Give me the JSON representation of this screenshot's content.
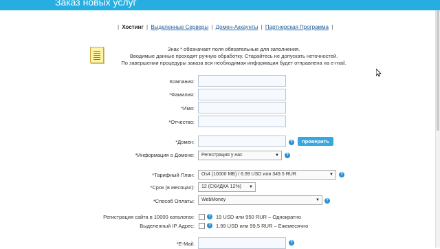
{
  "header": {
    "title": "Заказ новых услуг"
  },
  "nav": {
    "active": "Хостинг",
    "links": [
      "Выделенные Серверы",
      "Домен-Аккаунты",
      "Партнерская Программа"
    ]
  },
  "notes": {
    "line1": "Знак * обозначает поля обязательные для заполнения.",
    "line2": "Вводимые данные проходят ручную обработку. Старайтесь не допускать неточностей.",
    "line3": "По завершении процедуры заказа вся необходимая информация будет отправлена на e-mail."
  },
  "form": {
    "company_label": "Компания:",
    "lastname_label": "*Фамилия:",
    "firstname_label": "*Имя:",
    "middlename_label": "*Отчество:",
    "domain_label": "*Домен:",
    "check_button": "проверить",
    "domain_info_label": "*Информация о Домене:",
    "domain_info_value": "Регистрация у нас",
    "plan_label": "*Тарифный План:",
    "plan_value": "Os4 (10000 МБ) / 6.99 USD или 349.5 RUR",
    "term_label": "*Срок (в месяцах):",
    "term_value": "12 (СКИДКА 12%)",
    "payment_label": "*Способ Оплаты:",
    "payment_value": "WebMoney",
    "catalog_label": "Регистрация сайта в 10000 каталогах:",
    "catalog_text": "19 USD или 950 RUR – Однократно",
    "ip_label": "Выделенный IP Адрес:",
    "ip_text": "1.99 USD или 99.5 RUR – Ежемесячно",
    "email_label": "*E-Mail:"
  },
  "icons": {
    "help": "help-icon",
    "notes": "notes-icon",
    "cursor": "mouse-cursor-icon"
  },
  "colors": {
    "header_bg": "#26aee3",
    "button_bg": "#35a8e0",
    "link": "#1e5c9a"
  }
}
